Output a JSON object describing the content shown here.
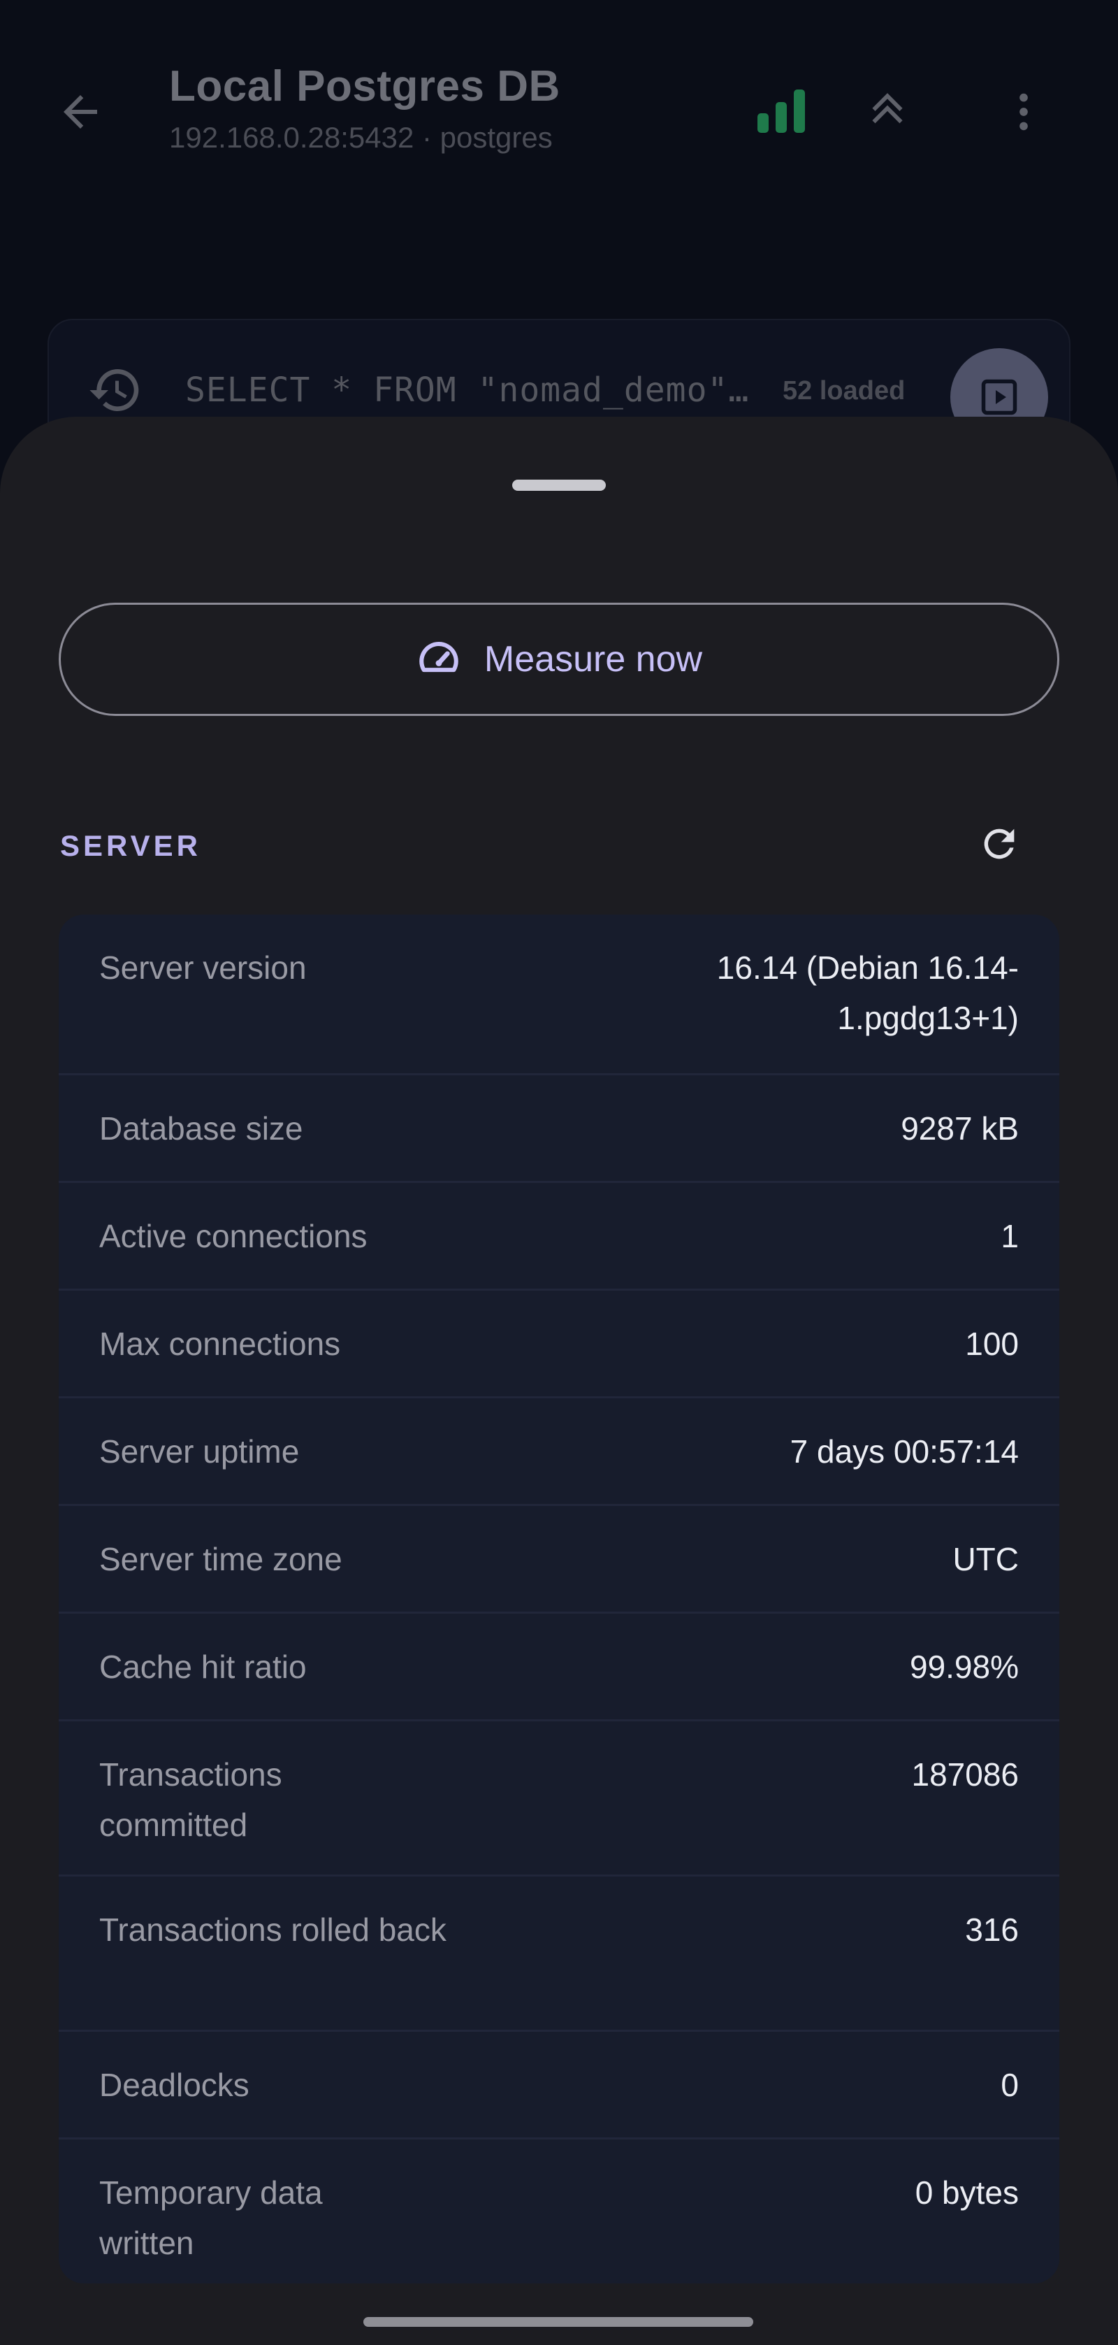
{
  "header": {
    "title": "Local Postgres DB",
    "subtitle": "192.168.0.28:5432 · postgres",
    "icons": {
      "back": "arrow-back-icon",
      "signal": "signal-strength-icon",
      "collapse": "double-chevron-up-icon",
      "menu": "more-vert-icon"
    },
    "signal_color": "#1f7a4b"
  },
  "query": {
    "text": "SELECT * FROM \"nomad_demo\"…",
    "loaded": "52 loaded"
  },
  "sheet": {
    "measure_button": "Measure now",
    "section_title": "SERVER",
    "rows": [
      {
        "label": "Server version",
        "value": "16.14 (Debian 16.14-1.pgdg13+1)"
      },
      {
        "label": "Database size",
        "value": "9287 kB"
      },
      {
        "label": "Active connections",
        "value": "1"
      },
      {
        "label": "Max connections",
        "value": "100"
      },
      {
        "label": "Server uptime",
        "value": "7 days 00:57:14"
      },
      {
        "label": "Server time zone",
        "value": "UTC"
      },
      {
        "label": "Cache hit ratio",
        "value": "99.98%"
      },
      {
        "label": "Transactions committed",
        "value": "187086"
      },
      {
        "label": "Transactions rolled back",
        "value": "316"
      },
      {
        "label": "Deadlocks",
        "value": "0"
      },
      {
        "label": "Temporary data written",
        "value": "0 bytes"
      }
    ]
  },
  "colors": {
    "accent": "#c7c0f7",
    "section": "#b8b1ec",
    "card": "#171c2c",
    "sheet": "#1c1c21"
  }
}
